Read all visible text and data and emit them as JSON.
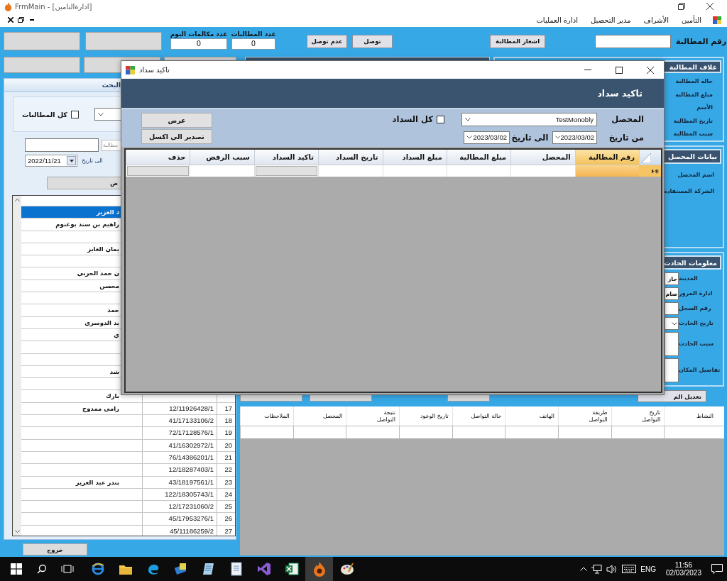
{
  "window": {
    "title": "FrmMain - [ادارةالتامين]"
  },
  "menu": [
    {
      "label": "التأمين"
    },
    {
      "label": "الأشراف"
    },
    {
      "label": "مدير التحصيل"
    },
    {
      "label": "ادارة العمليات"
    }
  ],
  "toolbar": {
    "counters": [
      {
        "label": "عدد المطالبات",
        "value": "0"
      },
      {
        "label": "عدد مكالمات اليوم",
        "value": "0"
      }
    ],
    "buttons": [
      "توصل",
      "عدم توصل"
    ],
    "notify_button": "اشعار المطالبة",
    "claim_label": "رقم المطالبة"
  },
  "search_panel": {
    "title": "البحث",
    "all_claims": {
      "label": "كل المطالبات",
      "checked": false
    },
    "claim_field": {
      "placeholder": "مطالبة"
    },
    "to_date_label": "الى تاريخ",
    "to_date": "2022/11/21",
    "show_button": "ض",
    "rows": [
      {
        "name": "د العزيز",
        "selected": true
      },
      {
        "name": "راهيم بن سند  بوغنوم",
        "selected": false
      },
      {
        "selected": false
      },
      {
        "name": "يمان الغايز",
        "selected": false
      },
      {
        "selected": false
      },
      {
        "name": "ن حمد الحربي",
        "selected": false
      },
      {
        "name": "محسن",
        "selected": false
      },
      {
        "selected": false
      },
      {
        "name": "حمد",
        "selected": false
      },
      {
        "name": "يد الدوسري",
        "selected": false
      },
      {
        "name": "ي",
        "selected": false
      },
      {
        "selected": false
      },
      {
        "selected": false
      },
      {
        "name": "شد",
        "selected": false
      },
      {
        "selected": false
      },
      {
        "name": "بارك",
        "selected": false
      },
      {
        "name": "رامي ممدوح",
        "code": "12/11926428/1",
        "number": "17",
        "selected": false
      },
      {
        "code": "41/17133106/2",
        "number": "18",
        "selected": false
      },
      {
        "code": "72/17128576/1",
        "number": "19",
        "selected": false
      },
      {
        "code": "41/16302972/1",
        "number": "20",
        "selected": false
      },
      {
        "code": "76/14386201/1",
        "number": "21",
        "selected": false
      },
      {
        "code": "12/18287403/1",
        "number": "22",
        "selected": false
      },
      {
        "name": "بندر عبد العزيز",
        "code": "43/18197561/1",
        "number": "23",
        "selected": false
      },
      {
        "code": "122/18305743/1",
        "number": "24",
        "selected": false
      },
      {
        "code": "12/17231060/2",
        "number": "25",
        "selected": false
      },
      {
        "code": "45/17953276/1",
        "number": "26",
        "selected": false
      },
      {
        "code": "45/11186259/2",
        "number": "27",
        "selected": false
      }
    ],
    "exit_button": "خروج"
  },
  "claim_cover": {
    "title": "غلاف المطالبة",
    "labels": [
      "حاله المطالبة",
      "مبلغ المطالبة",
      "الأسم",
      "تاريخ المطالبة",
      "سبب المطالبة"
    ]
  },
  "collector_info": {
    "title": "بيانات المحصل",
    "labels": [
      "اسم المحصل",
      "الشركة المستفادة"
    ]
  },
  "accident_info": {
    "title": "معلومات الحادث",
    "fields": [
      {
        "label": "المدينة",
        "kind": "text",
        "value": "جاز"
      },
      {
        "label": "ادارة المرور",
        "kind": "text",
        "value": "صام"
      },
      {
        "label": "رقم السجل",
        "kind": "text"
      },
      {
        "label": "تاريخ الحادث",
        "kind": "combo"
      },
      {
        "label": "سبب الحادث",
        "kind": "area"
      },
      {
        "label": "تفاصيل المكان",
        "kind": "area"
      }
    ],
    "edit_button": "تعديل الم"
  },
  "contacts_table": {
    "columns": [
      "النشاط",
      "تاريخ\nالتواصل",
      "طريقة\nالتواصل",
      "الهاتف",
      "حالة التواصل",
      "تاريخ الوعود",
      "نتيجة\nالتواصل",
      "المحصل",
      "الملاحظات"
    ]
  },
  "dialog": {
    "title": "تاكيد سداد",
    "heading": "تاكيد سداد",
    "collector_label": "المحصل",
    "collector": "TestMonobly",
    "all_payments": {
      "label": "كل السداد",
      "checked": false
    },
    "from_label": "من تاريخ",
    "from_date": "2023/03/02",
    "to_label": "الى تاريخ",
    "to_date": "2023/03/02",
    "buttons": [
      "عرض",
      "تصدير الى اكسل"
    ],
    "grid": {
      "columns": [
        {
          "label": "رقم المطالبة",
          "kind": "text",
          "selected": true
        },
        {
          "label": "المحصل",
          "kind": "text",
          "selected": false
        },
        {
          "label": "مبلغ المطالبة",
          "kind": "text",
          "selected": false
        },
        {
          "label": "مبلغ السداد",
          "kind": "text",
          "selected": false
        },
        {
          "label": "تاريخ السداد",
          "kind": "text",
          "selected": false
        },
        {
          "label": "تاكيد السداد",
          "kind": "button",
          "selected": false
        },
        {
          "label": "سبب الرفض",
          "kind": "text",
          "selected": false
        },
        {
          "label": "حذف",
          "kind": "button",
          "selected": false
        }
      ]
    }
  },
  "taskbar": {
    "apps": [
      {
        "active": false
      },
      {
        "active": false
      },
      {
        "active": false
      },
      {
        "active": false
      },
      {
        "active": false
      },
      {
        "active": false
      },
      {
        "active": false
      },
      {
        "active": false
      },
      {
        "active": true
      },
      {
        "active": false
      }
    ],
    "language": "ENG",
    "time": "11:56",
    "date": "02/03/2023"
  }
}
